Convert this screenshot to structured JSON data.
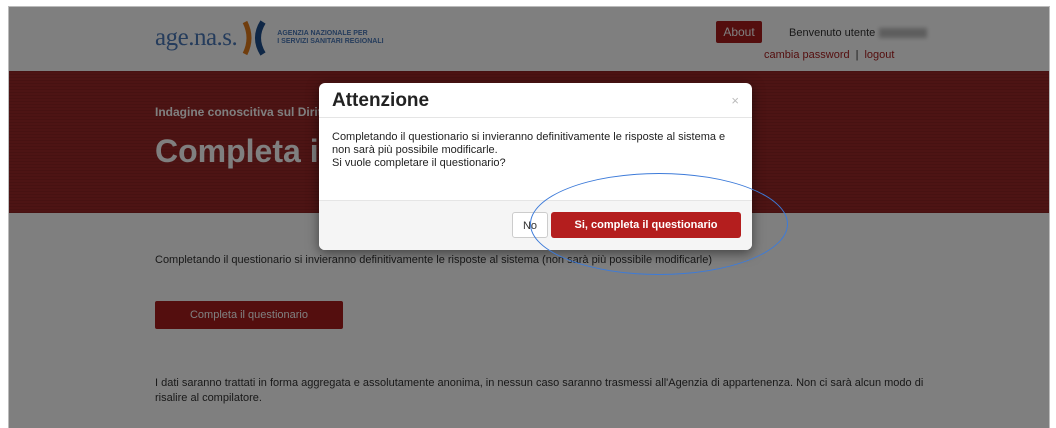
{
  "header": {
    "logo_text": "age.na.s.",
    "logo_sub_line1": "AGENZIA NAZIONALE PER",
    "logo_sub_line2": "I SERVIZI SANITARI REGIONALI",
    "about_label": "About",
    "welcome_text": "Benvenuto utente",
    "change_password": "cambia password",
    "separator": "|",
    "logout": "logout"
  },
  "banner": {
    "subtitle": "Indagine conoscitiva sul Diritto",
    "title": "Completa il questionario"
  },
  "content": {
    "intro": "Completando il questionario si invieranno definitivamente le risposte al sistema (non sarà più possibile modificarle)",
    "complete_button": "Completa il questionario",
    "privacy": "I dati saranno trattati in forma aggregata e assolutamente anonima, in nessun caso saranno trasmessi all'Agenzia di appartenenza. Non ci sarà alcun modo di risalire al compilatore."
  },
  "modal": {
    "title": "Attenzione",
    "close": "×",
    "body_line1": "Completando il questionario si invieranno definitivamente le risposte al sistema e",
    "body_line2": "non sarà più possibile modificarle.",
    "body_line3": "Si vuole completare il questionario?",
    "no_label": "No",
    "yes_label": "Si, completa il questionario"
  },
  "colors": {
    "brand_red": "#a91d1d",
    "brand_blue": "#4b79b8",
    "highlight_blue": "#3d7bd9"
  }
}
